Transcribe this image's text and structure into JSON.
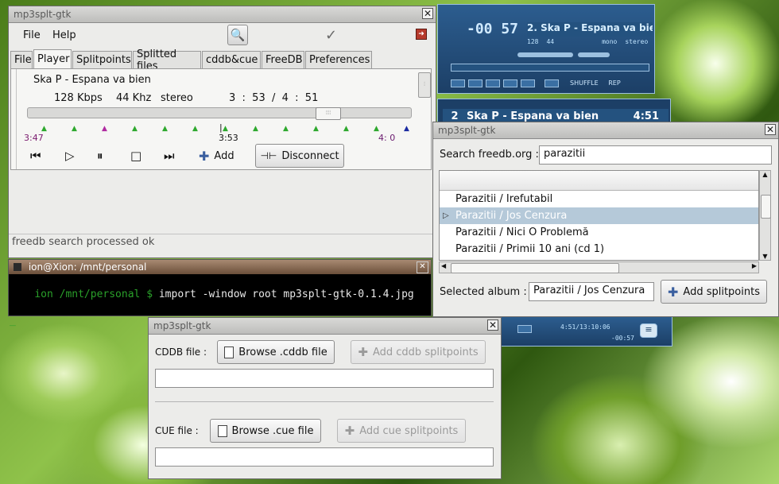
{
  "main_window": {
    "title": "mp3splt-gtk",
    "menu": [
      "File",
      "Help"
    ],
    "tabs": [
      "File",
      "Player",
      "Splitpoints",
      "Splitted files",
      "cddb&cue",
      "FreeDB",
      "Preferences"
    ],
    "song_title": "Ska P - Espana va bien",
    "bitrate": "128 Kbps",
    "frequency": "44 Khz",
    "mode": "stereo",
    "time": "3  :  53  /  4  :  51",
    "marker_start": "3:47",
    "marker_current": "3:53",
    "marker_end": "4: 0",
    "add_label": "Add",
    "disconnect_label": "Disconnect",
    "status": "freedb search processed ok"
  },
  "terminal": {
    "title": "ion@Xion: /mnt/personal",
    "prompt": "ion /mnt/personal $",
    "command": " import -window root mp3splt-gtk-0.1.4.jpg",
    "cursor": "_"
  },
  "freedb_window": {
    "title": "mp3splt-gtk",
    "search_label": "Search freedb.org :",
    "search_value": "parazitii",
    "results": [
      "Parazitii / Irefutabil",
      "Parazitii / Jos Cenzura",
      "Parazitii / Nici O Problemă",
      "Parazitii / Primii 10 ani (cd 1)"
    ],
    "selected_index": 1,
    "selected_album_label": "Selected album :",
    "selected_album_value": "Parazitii / Jos Cenzura",
    "add_splitpoints_label": "Add splitpoints"
  },
  "cddb_window": {
    "title": "mp3splt-gtk",
    "cddb_label": "CDDB file :",
    "browse_cddb_label": "Browse .cddb file",
    "add_cddb_label": "Add cddb splitpoints",
    "cue_label": "CUE file :",
    "browse_cue_label": "Browse .cue file",
    "add_cue_label": "Add cue splitpoints"
  },
  "xmms": {
    "time": "-00 57",
    "track": "2. Ska P - Espana va bie",
    "kbps": "128",
    "khz": "44",
    "mono_label": "mono",
    "stereo_label": "stereo",
    "shuffle_label": "SHUFFLE",
    "rep_label": "REP",
    "playlist_index": "2",
    "playlist_track": "Ska P - Espana va bien",
    "playlist_time": "4:51",
    "mini_time": "4:51/13:10:06",
    "mini_remaining": "-00:57"
  },
  "colors": {
    "accent_selection": "#b5c9d9",
    "terminal_bg": "#000000",
    "terminal_fg": "#1f8f1f",
    "xmms_blue": "#1c3f66"
  }
}
